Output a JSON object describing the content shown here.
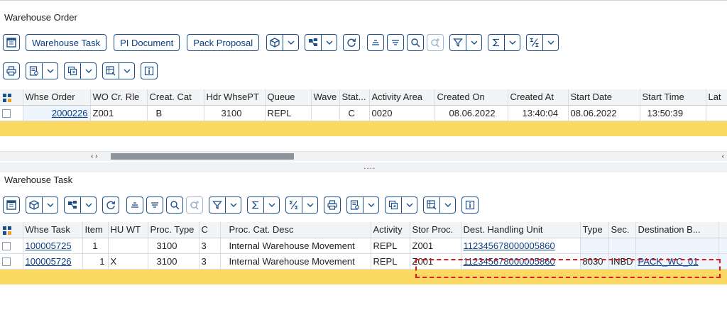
{
  "order_section": {
    "title": "Warehouse Order",
    "buttons": {
      "warehouse_task": "Warehouse Task",
      "pi_document": "PI Document",
      "pack_proposal": "Pack Proposal"
    },
    "columns": [
      "Whse Order",
      "WO Cr. Rle",
      "Creat. Cat",
      "Hdr WhsePT",
      "Queue",
      "Wave",
      "Stat...",
      "Activity Area",
      "Created On",
      "Created At",
      "Start Date",
      "Start Time",
      "Lat"
    ],
    "rows": [
      {
        "whse_order": "2000226",
        "wo_cr_rle": "Z001",
        "creat_cat": "B",
        "hdr_whsept": "3100",
        "queue": "REPL",
        "wave": "",
        "status": "C",
        "activity_area": "0020",
        "created_on": "08.06.2022",
        "created_at": "13:40:04",
        "start_date": "08.06.2022",
        "start_time": "13:50:39",
        "lat": ""
      }
    ],
    "scroll_arrows": "‹ ›",
    "scroll_right": "‹"
  },
  "splitter_dots": "....",
  "task_section": {
    "title": "Warehouse Task",
    "columns": [
      "Whse Task",
      "Item",
      "HU WT",
      "Proc. Type",
      "C",
      "Proc. Cat. Desc",
      "Activity",
      "Stor Proc.",
      "Dest. Handling Unit",
      "Type",
      "Sec.",
      "Destination B..."
    ],
    "rows": [
      {
        "whse_task": "100005725",
        "item": "1",
        "hu_wt": "",
        "proc_type": "3100",
        "c": "3",
        "proc_cat_desc": "Internal Warehouse Movement",
        "activity": "REPL",
        "stor_proc": "Z001",
        "dest_hu": "112345678000005860",
        "type": "",
        "sec": "",
        "dest_bin": ""
      },
      {
        "whse_task": "100005726",
        "item": "1",
        "hu_wt": "X",
        "proc_type": "3100",
        "c": "3",
        "proc_cat_desc": "Internal Warehouse Movement",
        "activity": "REPL",
        "stor_proc": "Z001",
        "dest_hu": "112345678000005860",
        "type": "8030",
        "sec": "INBD",
        "dest_bin": "PACK_WC_01"
      }
    ]
  },
  "colors": {
    "accent": "#0a3f86",
    "border": "#1d4f8c",
    "yellow_row": "#fbd961",
    "highlight": "#e0181f",
    "selected_col": "#eef5fc"
  },
  "icons": [
    "layout-icon",
    "cube-icon",
    "chevron-down-icon",
    "hierarchy-icon",
    "refresh-icon",
    "sort-ascending-icon",
    "sort-descending-icon",
    "search-icon",
    "search-next-icon",
    "filter-icon",
    "sum-icon",
    "subtotal-icon",
    "print-icon",
    "export-icon",
    "view-icon",
    "layout-select-icon",
    "info-icon",
    "column-settings-icon"
  ]
}
